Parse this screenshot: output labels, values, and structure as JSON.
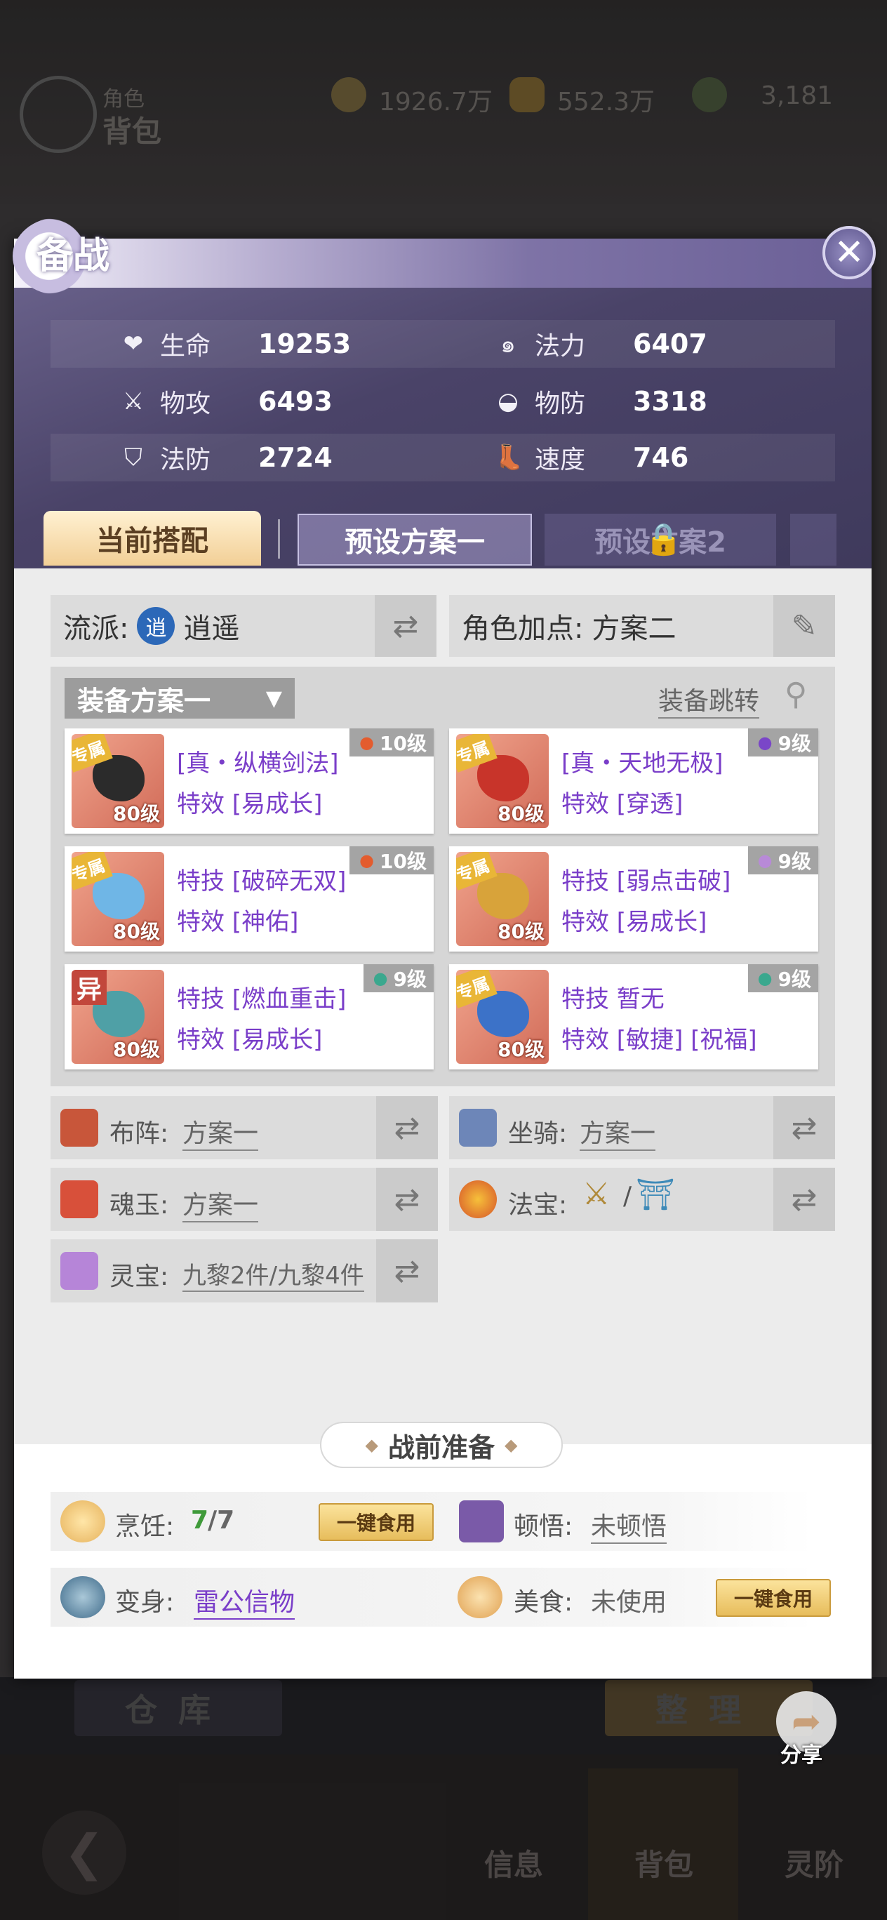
{
  "background": {
    "header_small": "角色",
    "header_big": "背包",
    "currency": [
      "1926.7万",
      "552.3万",
      "3,181"
    ],
    "warehouse_button": "仓库",
    "sort_button": "整理",
    "share_label": "分享",
    "nav": [
      "信息",
      "背包",
      "灵阶"
    ]
  },
  "dialog": {
    "title": "备战",
    "stats": [
      {
        "icon": "heart-icon",
        "label": "生命",
        "value": "19253"
      },
      {
        "icon": "swirl-icon",
        "label": "法力",
        "value": "6407"
      },
      {
        "icon": "sword-icon",
        "label": "物攻",
        "value": "6493"
      },
      {
        "icon": "armor-icon",
        "label": "物防",
        "value": "3318"
      },
      {
        "icon": "shield-icon",
        "label": "法防",
        "value": "2724"
      },
      {
        "icon": "boot-icon",
        "label": "速度",
        "value": "746"
      }
    ],
    "tabs": {
      "current": "当前搭配",
      "preset1": "预设方案一",
      "preset2": "预设方案2"
    },
    "school": {
      "label": "流派:",
      "value": "逍遥"
    },
    "attr_points": {
      "label": "角色加点:",
      "value": "方案二"
    },
    "equipment": {
      "plan_label": "装备方案一",
      "jump_label": "装备跳转",
      "items": [
        {
          "tag": "专属",
          "level": "80级",
          "line1": "[真・纵横剑法]",
          "line2": "特效 [易成长]",
          "gem": "10级",
          "gem_color": "#e35c2e",
          "art_color": "#2b2b2b"
        },
        {
          "tag": "专属",
          "level": "80级",
          "line1": "[真・天地无极]",
          "line2": "特效 [穿透]",
          "gem": "9级",
          "gem_color": "#7a46c8",
          "art_color": "#c8342a"
        },
        {
          "tag": "专属",
          "level": "80级",
          "line1": "特技 [破碎无双]",
          "line2": "特效 [神佑]",
          "gem": "10级",
          "gem_color": "#e35c2e",
          "art_color": "#6fb6e6"
        },
        {
          "tag": "专属",
          "level": "80级",
          "line1": "特技 [弱点击破]",
          "line2": "特效 [易成长]",
          "gem": "9级",
          "gem_color": "#b88ad8",
          "art_color": "#d8a33a"
        },
        {
          "tag": "异",
          "level": "80级",
          "line1": "特技 [燃血重击]",
          "line2": "特效 [易成长]",
          "gem": "9级",
          "gem_color": "#3aa88e",
          "art_color": "#4fa0a6"
        },
        {
          "tag": "专属",
          "level": "80级",
          "line1": "特技 暂无",
          "line2": "特效 [敏捷] [祝福]",
          "gem": "9级",
          "gem_color": "#3aa88e",
          "art_color": "#3c72c8"
        }
      ]
    },
    "options": {
      "formation": {
        "label": "布阵:",
        "value": "方案一"
      },
      "mount": {
        "label": "坐骑:",
        "value": "方案一"
      },
      "soul_jade": {
        "label": "魂玉:",
        "value": "方案一"
      },
      "treasure": {
        "label": "法宝:",
        "value": "/"
      },
      "spirit_treasure": {
        "label": "灵宝:",
        "value": "九黎2件/九黎4件"
      }
    },
    "prep": {
      "title": "战前准备",
      "cooking": {
        "label": "烹饪:",
        "value_num": "7",
        "value_den": "/7",
        "button": "一键食用"
      },
      "insight": {
        "label": "顿悟:",
        "value": "未顿悟"
      },
      "transform": {
        "label": "变身:",
        "value": "雷公信物"
      },
      "food": {
        "label": "美食:",
        "value": "未使用",
        "button": "一键食用"
      }
    }
  }
}
